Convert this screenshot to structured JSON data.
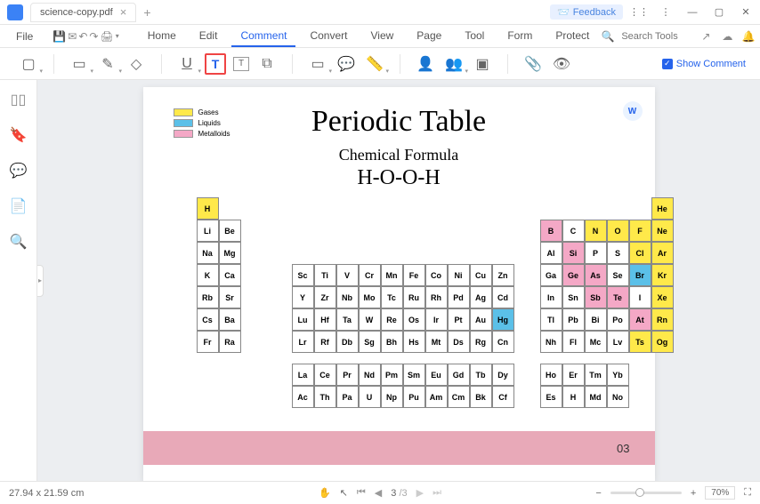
{
  "tab": {
    "name": "science-copy.pdf"
  },
  "feedback": "Feedback",
  "menu": {
    "file": "File",
    "tabs": [
      "Home",
      "Edit",
      "Comment",
      "Convert",
      "View",
      "Page",
      "Tool",
      "Form",
      "Protect"
    ],
    "active": 2,
    "search_placeholder": "Search Tools"
  },
  "toolbar": {
    "show_comment": "Show Comment"
  },
  "legend": [
    "Gases",
    "Liquids",
    "Metalloids"
  ],
  "doc": {
    "title": "Periodic Table",
    "sub": "Chemical Formula",
    "formula": "H-O-O-H"
  },
  "elements": [
    {
      "s": "H",
      "r": 0,
      "c": 0,
      "cls": "yellow",
      "top": 0
    },
    {
      "s": "He",
      "r": 0,
      "c": 17,
      "cls": "yellow",
      "top": 0
    },
    {
      "s": "Li",
      "r": 1,
      "c": 0
    },
    {
      "s": "Be",
      "r": 1,
      "c": 1
    },
    {
      "s": "B",
      "r": 1,
      "c": 12,
      "cls": "pink"
    },
    {
      "s": "C",
      "r": 1,
      "c": 13
    },
    {
      "s": "N",
      "r": 1,
      "c": 14,
      "cls": "yellow"
    },
    {
      "s": "O",
      "r": 1,
      "c": 15,
      "cls": "yellow"
    },
    {
      "s": "F",
      "r": 1,
      "c": 16,
      "cls": "yellow"
    },
    {
      "s": "Ne",
      "r": 1,
      "c": 17,
      "cls": "yellow"
    },
    {
      "s": "Na",
      "r": 2,
      "c": 0
    },
    {
      "s": "Mg",
      "r": 2,
      "c": 1
    },
    {
      "s": "Al",
      "r": 2,
      "c": 12
    },
    {
      "s": "Si",
      "r": 2,
      "c": 13,
      "cls": "pink"
    },
    {
      "s": "P",
      "r": 2,
      "c": 14
    },
    {
      "s": "S",
      "r": 2,
      "c": 15
    },
    {
      "s": "Cl",
      "r": 2,
      "c": 16,
      "cls": "yellow"
    },
    {
      "s": "Ar",
      "r": 2,
      "c": 17,
      "cls": "yellow"
    },
    {
      "s": "K",
      "r": 3,
      "c": 0
    },
    {
      "s": "Ca",
      "r": 3,
      "c": 1
    },
    {
      "s": "Sc",
      "r": 3,
      "c": 2
    },
    {
      "s": "Ti",
      "r": 3,
      "c": 3
    },
    {
      "s": "V",
      "r": 3,
      "c": 4
    },
    {
      "s": "Cr",
      "r": 3,
      "c": 5
    },
    {
      "s": "Mn",
      "r": 3,
      "c": 6
    },
    {
      "s": "Fe",
      "r": 3,
      "c": 7
    },
    {
      "s": "Co",
      "r": 3,
      "c": 8
    },
    {
      "s": "Ni",
      "r": 3,
      "c": 9
    },
    {
      "s": "Cu",
      "r": 3,
      "c": 10
    },
    {
      "s": "Zn",
      "r": 3,
      "c": 11
    },
    {
      "s": "Ga",
      "r": 3,
      "c": 12
    },
    {
      "s": "Ge",
      "r": 3,
      "c": 13,
      "cls": "pink"
    },
    {
      "s": "As",
      "r": 3,
      "c": 14,
      "cls": "pink"
    },
    {
      "s": "Se",
      "r": 3,
      "c": 15
    },
    {
      "s": "Br",
      "r": 3,
      "c": 16,
      "cls": "blue"
    },
    {
      "s": "Kr",
      "r": 3,
      "c": 17,
      "cls": "yellow"
    },
    {
      "s": "Rb",
      "r": 4,
      "c": 0
    },
    {
      "s": "Sr",
      "r": 4,
      "c": 1
    },
    {
      "s": "Y",
      "r": 4,
      "c": 2
    },
    {
      "s": "Zr",
      "r": 4,
      "c": 3
    },
    {
      "s": "Nb",
      "r": 4,
      "c": 4
    },
    {
      "s": "Mo",
      "r": 4,
      "c": 5
    },
    {
      "s": "Tc",
      "r": 4,
      "c": 6
    },
    {
      "s": "Ru",
      "r": 4,
      "c": 7
    },
    {
      "s": "Rh",
      "r": 4,
      "c": 8
    },
    {
      "s": "Pd",
      "r": 4,
      "c": 9
    },
    {
      "s": "Ag",
      "r": 4,
      "c": 10
    },
    {
      "s": "Cd",
      "r": 4,
      "c": 11
    },
    {
      "s": "In",
      "r": 4,
      "c": 12
    },
    {
      "s": "Sn",
      "r": 4,
      "c": 13
    },
    {
      "s": "Sb",
      "r": 4,
      "c": 14,
      "cls": "pink"
    },
    {
      "s": "Te",
      "r": 4,
      "c": 15,
      "cls": "pink"
    },
    {
      "s": "I",
      "r": 4,
      "c": 16
    },
    {
      "s": "Xe",
      "r": 4,
      "c": 17,
      "cls": "yellow"
    },
    {
      "s": "Cs",
      "r": 5,
      "c": 0
    },
    {
      "s": "Ba",
      "r": 5,
      "c": 1
    },
    {
      "s": "Lu",
      "r": 5,
      "c": 2
    },
    {
      "s": "Hf",
      "r": 5,
      "c": 3
    },
    {
      "s": "Ta",
      "r": 5,
      "c": 4
    },
    {
      "s": "W",
      "r": 5,
      "c": 5
    },
    {
      "s": "Re",
      "r": 5,
      "c": 6
    },
    {
      "s": "Os",
      "r": 5,
      "c": 7
    },
    {
      "s": "Ir",
      "r": 5,
      "c": 8
    },
    {
      "s": "Pt",
      "r": 5,
      "c": 9
    },
    {
      "s": "Au",
      "r": 5,
      "c": 10
    },
    {
      "s": "Hg",
      "r": 5,
      "c": 11,
      "cls": "blue"
    },
    {
      "s": "Tl",
      "r": 5,
      "c": 12
    },
    {
      "s": "Pb",
      "r": 5,
      "c": 13
    },
    {
      "s": "Bi",
      "r": 5,
      "c": 14
    },
    {
      "s": "Po",
      "r": 5,
      "c": 15
    },
    {
      "s": "At",
      "r": 5,
      "c": 16,
      "cls": "pink"
    },
    {
      "s": "Rn",
      "r": 5,
      "c": 17,
      "cls": "yellow"
    },
    {
      "s": "Fr",
      "r": 6,
      "c": 0
    },
    {
      "s": "Ra",
      "r": 6,
      "c": 1
    },
    {
      "s": "Lr",
      "r": 6,
      "c": 2
    },
    {
      "s": "Rf",
      "r": 6,
      "c": 3
    },
    {
      "s": "Db",
      "r": 6,
      "c": 4
    },
    {
      "s": "Sg",
      "r": 6,
      "c": 5
    },
    {
      "s": "Bh",
      "r": 6,
      "c": 6
    },
    {
      "s": "Hs",
      "r": 6,
      "c": 7
    },
    {
      "s": "Mt",
      "r": 6,
      "c": 8
    },
    {
      "s": "Ds",
      "r": 6,
      "c": 9
    },
    {
      "s": "Rg",
      "r": 6,
      "c": 10
    },
    {
      "s": "Cn",
      "r": 6,
      "c": 11
    },
    {
      "s": "Nh",
      "r": 6,
      "c": 12
    },
    {
      "s": "Fl",
      "r": 6,
      "c": 13
    },
    {
      "s": "Mc",
      "r": 6,
      "c": 14
    },
    {
      "s": "Lv",
      "r": 6,
      "c": 15
    },
    {
      "s": "Ts",
      "r": 6,
      "c": 16,
      "cls": "yellow"
    },
    {
      "s": "Og",
      "r": 6,
      "c": 17,
      "cls": "yellow"
    },
    {
      "s": "La",
      "r": 8,
      "c": 2
    },
    {
      "s": "Ce",
      "r": 8,
      "c": 3
    },
    {
      "s": "Pr",
      "r": 8,
      "c": 4
    },
    {
      "s": "Nd",
      "r": 8,
      "c": 5
    },
    {
      "s": "Pm",
      "r": 8,
      "c": 6
    },
    {
      "s": "Sm",
      "r": 8,
      "c": 7
    },
    {
      "s": "Eu",
      "r": 8,
      "c": 8
    },
    {
      "s": "Gd",
      "r": 8,
      "c": 9
    },
    {
      "s": "Tb",
      "r": 8,
      "c": 10
    },
    {
      "s": "Dy",
      "r": 8,
      "c": 11
    },
    {
      "s": "Ho",
      "r": 8,
      "c": 12
    },
    {
      "s": "Er",
      "r": 8,
      "c": 13
    },
    {
      "s": "Tm",
      "r": 8,
      "c": 14
    },
    {
      "s": "Yb",
      "r": 8,
      "c": 15
    },
    {
      "s": "Ac",
      "r": 9,
      "c": 2
    },
    {
      "s": "Th",
      "r": 9,
      "c": 3
    },
    {
      "s": "Pa",
      "r": 9,
      "c": 4
    },
    {
      "s": "U",
      "r": 9,
      "c": 5
    },
    {
      "s": "Np",
      "r": 9,
      "c": 6
    },
    {
      "s": "Pu",
      "r": 9,
      "c": 7
    },
    {
      "s": "Am",
      "r": 9,
      "c": 8
    },
    {
      "s": "Cm",
      "r": 9,
      "c": 9
    },
    {
      "s": "Bk",
      "r": 9,
      "c": 10
    },
    {
      "s": "Cf",
      "r": 9,
      "c": 11
    },
    {
      "s": "Es",
      "r": 9,
      "c": 12
    },
    {
      "s": "H",
      "r": 9,
      "c": 13
    },
    {
      "s": "Md",
      "r": 9,
      "c": 14
    },
    {
      "s": "No",
      "r": 9,
      "c": 15
    }
  ],
  "page_num": "03",
  "status": {
    "dim": "27.94 x 21.59 cm",
    "page": "3",
    "total": "/3",
    "zoom": "70%"
  }
}
